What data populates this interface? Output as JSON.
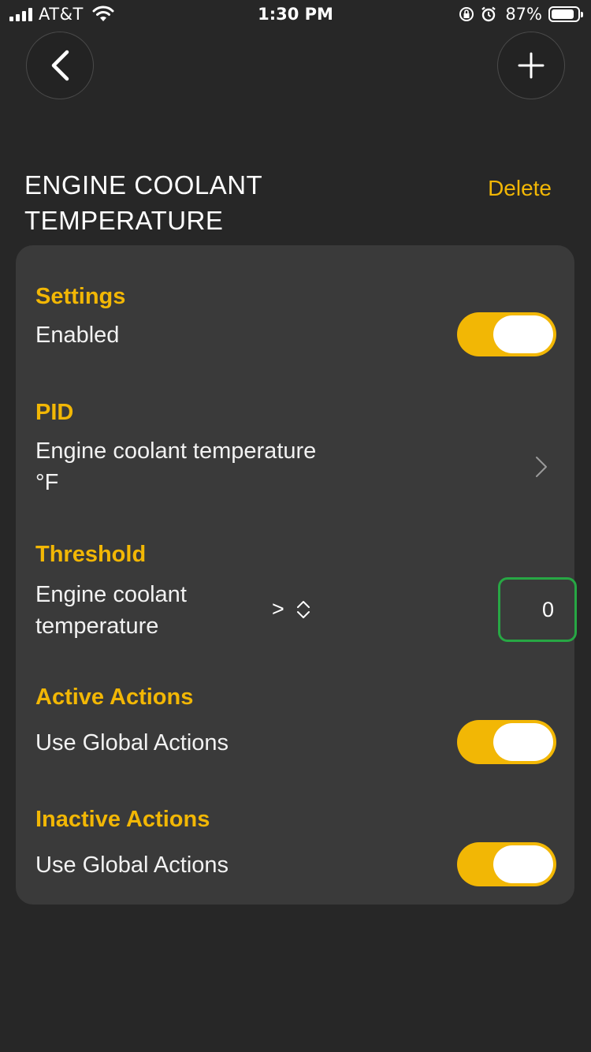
{
  "status_bar": {
    "carrier": "AT&T",
    "time": "1:30 PM",
    "battery_percent": "87%",
    "battery_level": 0.87,
    "icons": [
      "signal-icon",
      "wifi-icon",
      "orientation-lock-icon",
      "alarm-icon",
      "battery-icon"
    ]
  },
  "nav": {
    "back_icon": "chevron-left-icon",
    "add_icon": "plus-icon"
  },
  "header": {
    "title_line1": "ENGINE COOLANT",
    "title_line2": "TEMPERATURE",
    "delete_label": "Delete"
  },
  "card": {
    "settings": {
      "label": "Settings",
      "enabled_label": "Enabled",
      "enabled": true
    },
    "pid": {
      "label": "PID",
      "name": "Engine coolant temperature",
      "unit": "°F"
    },
    "threshold": {
      "label": "Threshold",
      "metric_line1": "Engine coolant",
      "metric_line2": "temperature",
      "operator": ">",
      "value": "0"
    },
    "active_actions": {
      "label": "Active Actions",
      "option_label": "Use Global Actions",
      "enabled": true
    },
    "inactive_actions": {
      "label": "Inactive Actions",
      "option_label": "Use Global Actions",
      "enabled": true
    }
  },
  "colors": {
    "accent": "#f2b705",
    "background": "#272727",
    "card": "#3a3a3a",
    "input_border": "#27a744"
  }
}
